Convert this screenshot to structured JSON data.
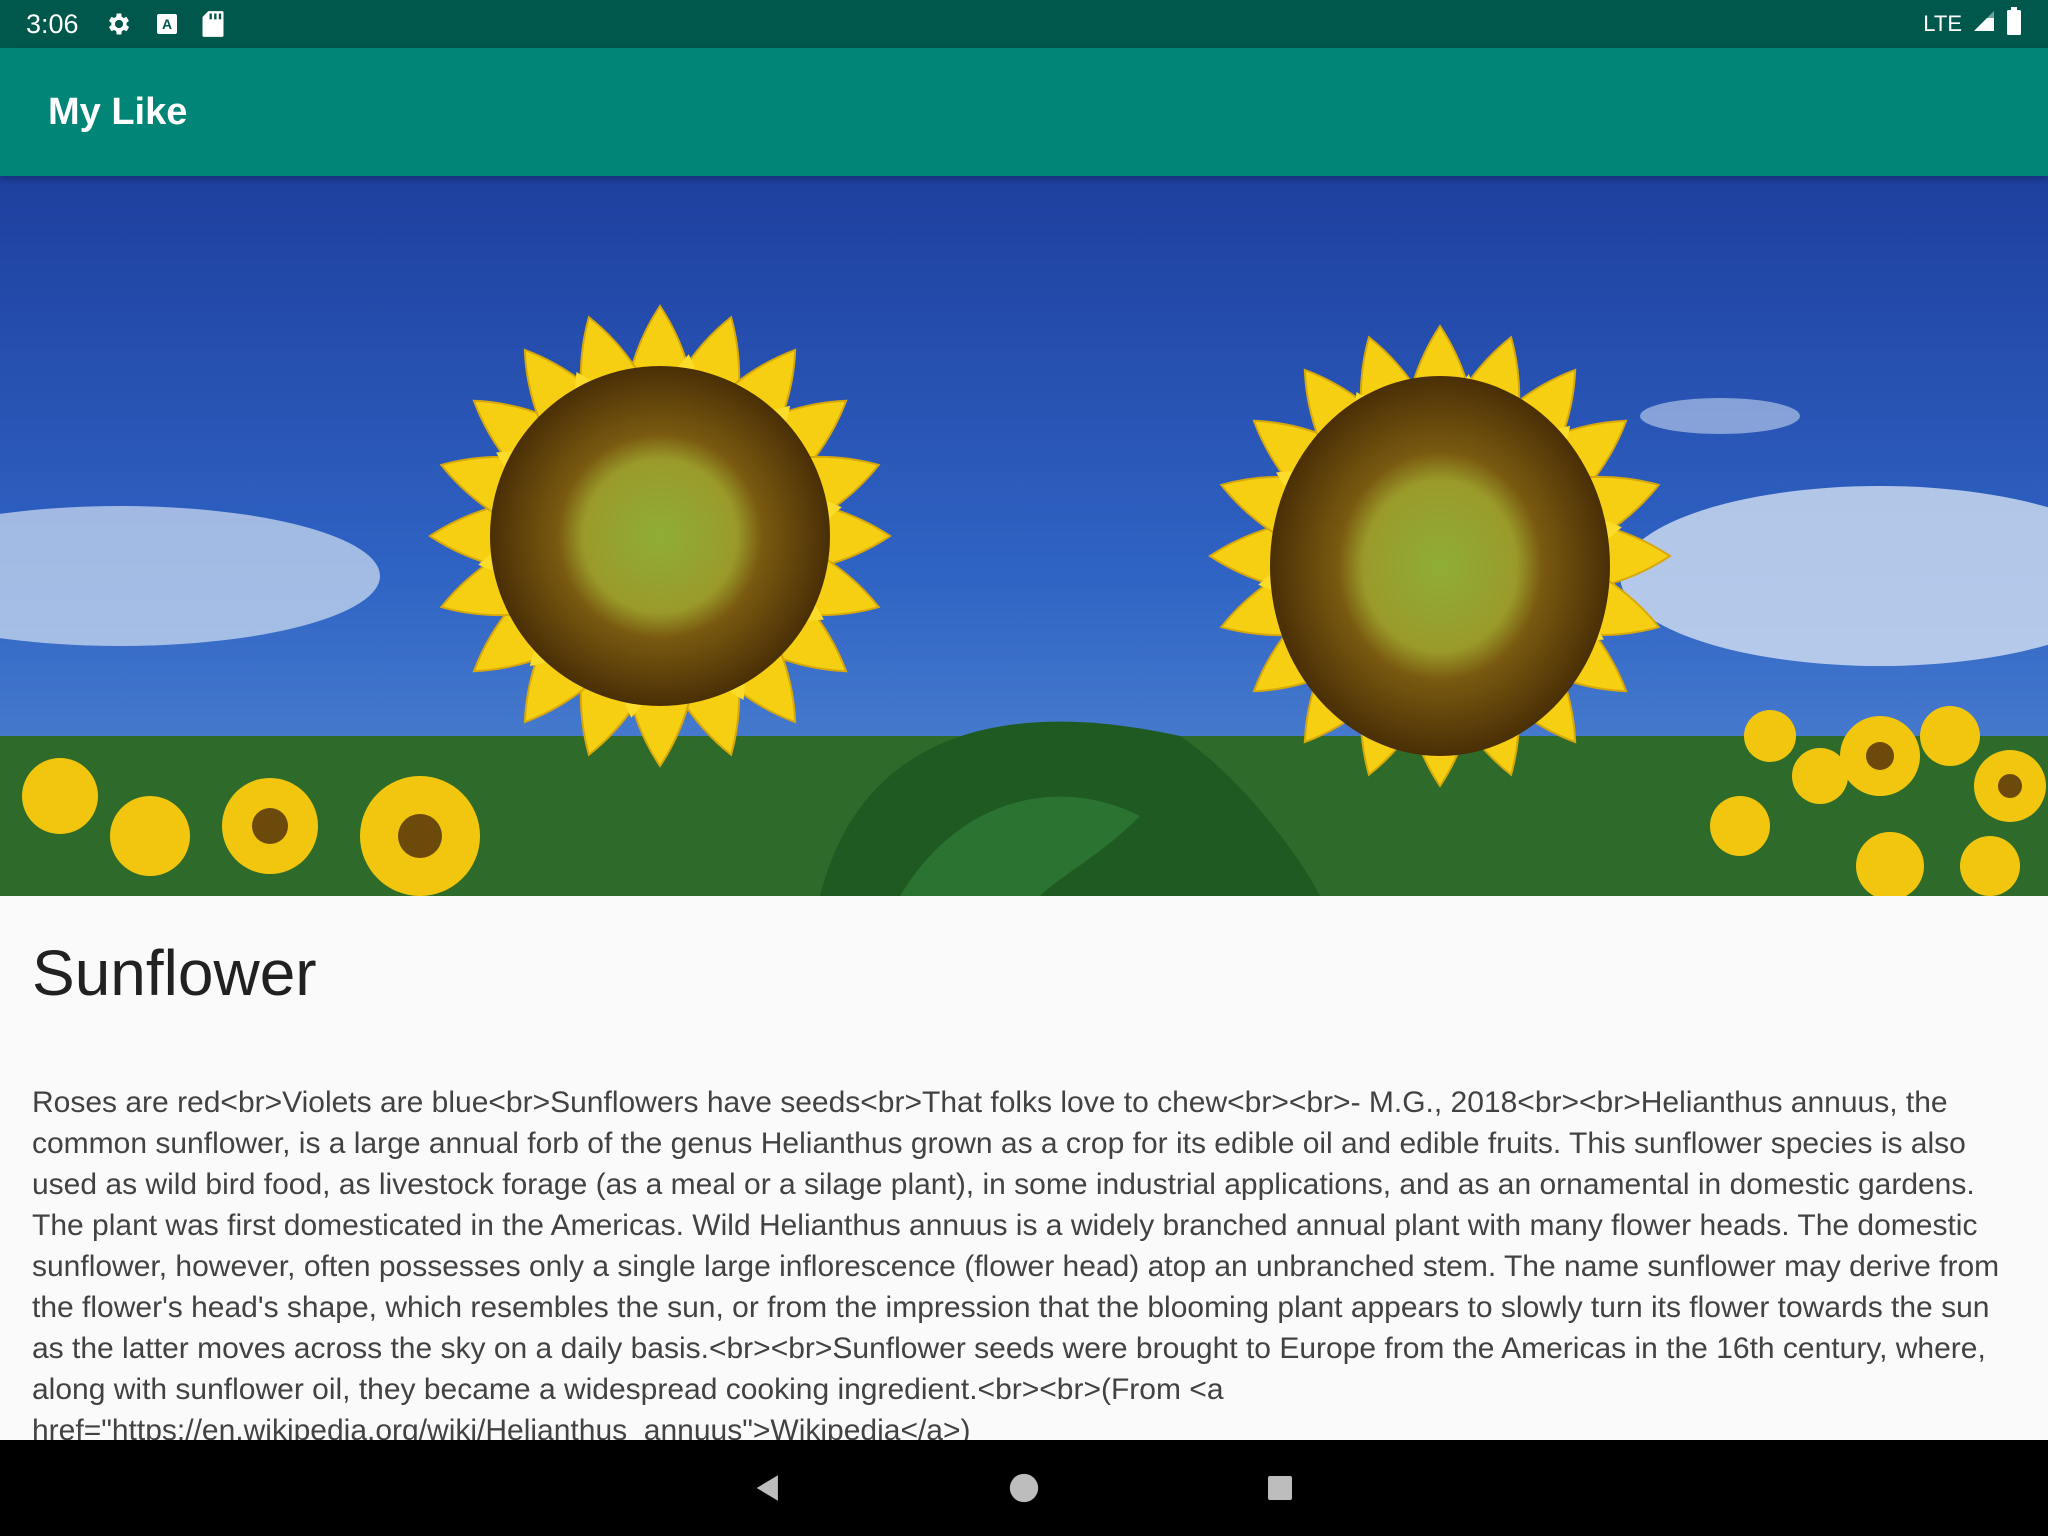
{
  "status_bar": {
    "time": "3:06",
    "icons": [
      "settings-icon",
      "a-notification-icon",
      "sd-card-icon"
    ],
    "network": "LTE",
    "right_icons": [
      "signal-icon",
      "battery-icon"
    ]
  },
  "app_bar": {
    "title": "My Like"
  },
  "hero": {
    "icon": "sunflower-photo"
  },
  "flower": {
    "name": "Sunflower",
    "description": "Roses are red<br>Violets are blue<br>Sunflowers have seeds<br>That folks love to chew<br><br>- M.G., 2018<br><br>Helianthus annuus, the common sunflower, is a large annual forb of the genus Helianthus grown as a crop for its edible oil and edible fruits. This sunflower species is also used as wild bird food, as livestock forage (as a meal or a silage plant), in some industrial applications, and as an ornamental in domestic gardens. The plant was first domesticated in the Americas. Wild Helianthus annuus is a widely branched annual plant with many flower heads. The domestic sunflower, however, often possesses only a single large inflorescence (flower head) atop an unbranched stem. The name sunflower may derive from the flower's head's shape, which resembles the sun, or from the impression that the blooming plant appears to slowly turn its flower towards the sun as the latter moves across the sky on a daily basis.<br><br>Sunflower seeds were brought to Europe from the Americas in the 16th century, where, along with sunflower oil, they became a widespread cooking ingredient.<br><br>(From <a href=\"https://en.wikipedia.org/wiki/Helianthus_annuus\">Wikipedia</a>)"
  },
  "nav_bar": {
    "buttons": [
      "back-icon",
      "home-icon",
      "recents-icon"
    ]
  },
  "colors": {
    "status_bar": "#00574b",
    "app_bar": "#008577",
    "background": "#fafafa",
    "text_primary": "#212121",
    "text_body": "#424242"
  }
}
